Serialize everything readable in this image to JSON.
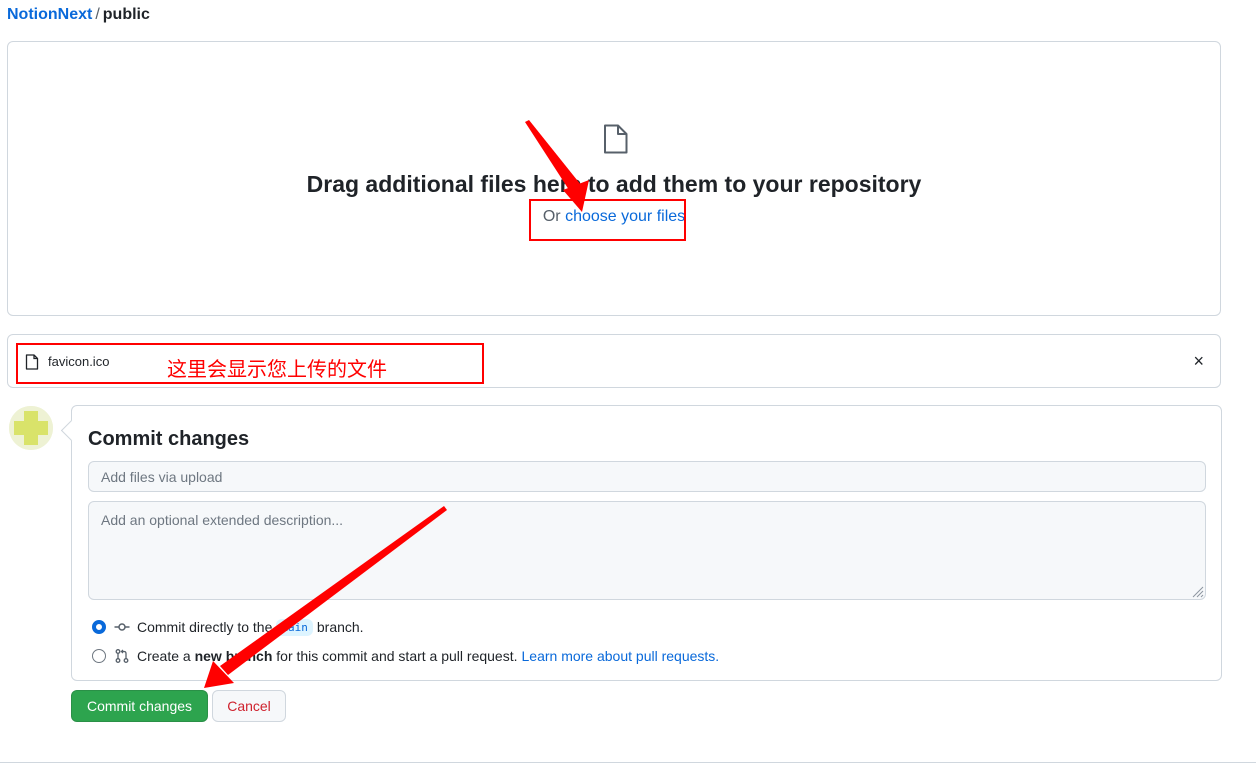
{
  "breadcrumb": {
    "repo": "NotionNext",
    "separator": "/",
    "directory": "public"
  },
  "dropzone": {
    "title": "Drag additional files here to add them to your repository",
    "prefix": "Or",
    "choose_link": "choose your files",
    "icon": "file-icon"
  },
  "uploaded_file": {
    "name": "favicon.ico",
    "icon": "file-icon",
    "remove_glyph": "×"
  },
  "annotation": {
    "label": "这里会显示您上传的文件",
    "color": "#ff0000"
  },
  "commit": {
    "title": "Commit changes",
    "summary_placeholder": "Add files via upload",
    "description_placeholder": "Add an optional extended description...",
    "option_direct": {
      "prefix": "Commit directly to the",
      "branch": "main",
      "suffix": "branch.",
      "selected": true
    },
    "option_new": {
      "prefix": "Create a",
      "bold": "new branch",
      "suffix": "for this commit and start a pull request.",
      "link": "Learn more about pull requests.",
      "selected": false
    }
  },
  "buttons": {
    "commit": "Commit changes",
    "cancel": "Cancel"
  },
  "colors": {
    "link": "#0969da",
    "primary": "#2da44e",
    "danger": "#cf222e",
    "border": "#d0d7de",
    "annotation": "#ff0000"
  }
}
